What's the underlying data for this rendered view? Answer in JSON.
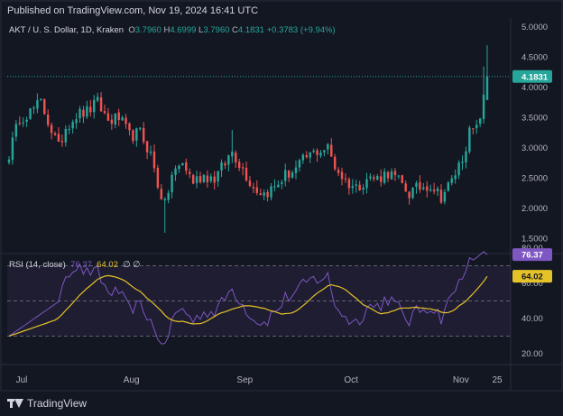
{
  "header": {
    "published": "Published on TradingView.com, Nov 19, 2024 16:41 UTC"
  },
  "legend": {
    "symbol": "AKT / U. S. Dollar, 1D, Kraken",
    "o_label": "O",
    "o_value": "3.7960",
    "h_label": "H",
    "h_value": "4.6999",
    "l_label": "L",
    "l_value": "3.7960",
    "c_label": "C",
    "c_value": "4.1831",
    "change": "+0.3783 (+9.94%)"
  },
  "rsi_legend": {
    "label": "RSI (14, close)",
    "rsi_value": "76.37",
    "ma_value": "64.02",
    "extra": "∅ ∅"
  },
  "footer": {
    "brand": "TradingView"
  },
  "chart_data": [
    {
      "type": "candlestick",
      "price_axis_ticks": [
        "5.0000",
        "4.5000",
        "4.0000",
        "3.5000",
        "3.0000",
        "2.5000",
        "2.0000",
        "1.5000"
      ],
      "ylim": [
        1.3,
        5.15
      ],
      "last_price_label": "4.1831",
      "time_axis_ticks": [
        "Jul",
        "Aug",
        "Sep",
        "Oct",
        "Nov",
        "25"
      ],
      "colors": {
        "up": "#26a69a",
        "down": "#ef5350"
      },
      "anchors": [
        [
          0,
          2.9
        ],
        [
          3,
          3.5
        ],
        [
          6,
          3.6
        ],
        [
          9,
          3.75
        ],
        [
          12,
          3.3
        ],
        [
          14,
          3.0
        ],
        [
          16,
          3.35
        ],
        [
          19,
          3.55
        ],
        [
          22,
          3.6
        ],
        [
          25,
          3.75
        ],
        [
          28,
          3.45
        ],
        [
          31,
          3.5
        ],
        [
          34,
          3.2
        ],
        [
          37,
          3.25
        ],
        [
          40,
          2.9
        ],
        [
          42,
          2.4
        ],
        [
          44,
          2.05
        ],
        [
          46,
          2.55
        ],
        [
          49,
          2.75
        ],
        [
          52,
          2.45
        ],
        [
          55,
          2.55
        ],
        [
          58,
          2.5
        ],
        [
          61,
          2.75
        ],
        [
          63,
          2.95
        ],
        [
          66,
          2.65
        ],
        [
          69,
          2.35
        ],
        [
          72,
          2.25
        ],
        [
          75,
          2.35
        ],
        [
          78,
          2.55
        ],
        [
          81,
          2.65
        ],
        [
          84,
          2.85
        ],
        [
          87,
          2.95
        ],
        [
          90,
          3.0
        ],
        [
          92,
          2.7
        ],
        [
          95,
          2.45
        ],
        [
          98,
          2.35
        ],
        [
          101,
          2.5
        ],
        [
          104,
          2.5
        ],
        [
          107,
          2.6
        ],
        [
          110,
          2.45
        ],
        [
          113,
          2.25
        ],
        [
          116,
          2.35
        ],
        [
          119,
          2.4
        ],
        [
          122,
          2.2
        ],
        [
          125,
          2.45
        ],
        [
          128,
          2.85
        ],
        [
          130,
          3.25
        ],
        [
          132,
          3.3
        ],
        [
          134,
          3.8
        ],
        [
          135,
          4.1831
        ]
      ]
    },
    {
      "type": "line",
      "name": "RSI (14, close)",
      "ylim": [
        20,
        80
      ],
      "y_ticks": [
        "80.00",
        "60.00",
        "40.00",
        "20.00"
      ],
      "bands": [
        70,
        50,
        30
      ],
      "rsi_value": 76.37,
      "ma_value": 64.02,
      "colors": {
        "rsi": "#7e57c2",
        "ma": "#e6c229"
      }
    }
  ]
}
